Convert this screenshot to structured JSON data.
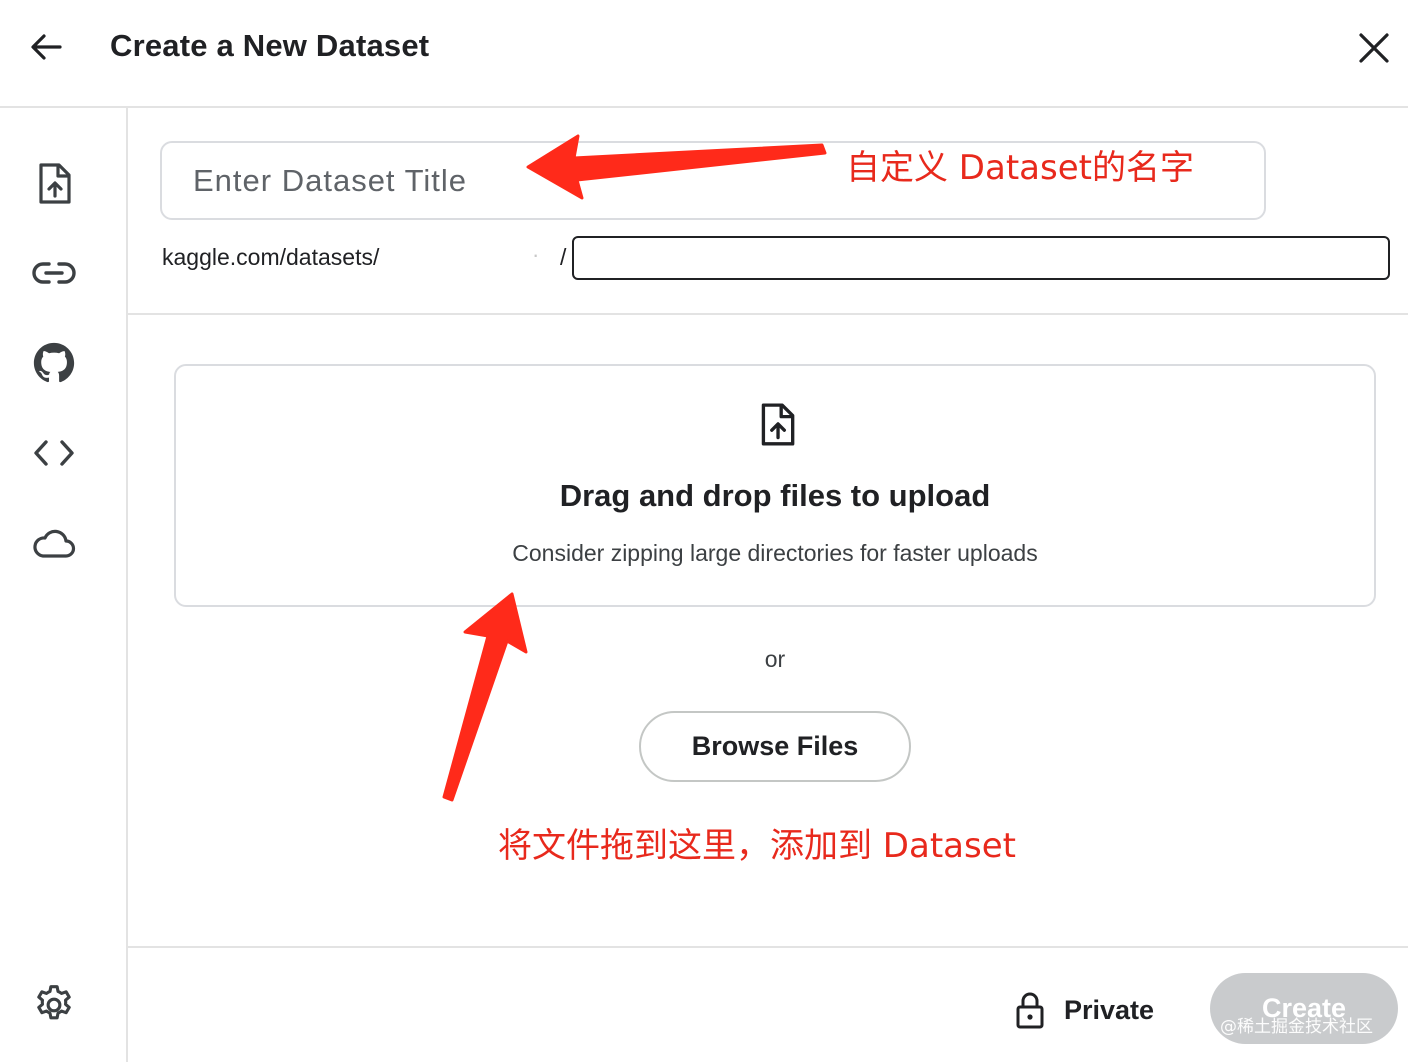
{
  "header": {
    "title": "Create a New Dataset",
    "back_icon": "arrow-left-icon",
    "close_icon": "close-icon"
  },
  "sidebar": {
    "items": [
      {
        "name": "file-upload",
        "icon": "file-upload-icon"
      },
      {
        "name": "link",
        "icon": "link-icon"
      },
      {
        "name": "github",
        "icon": "github-icon"
      },
      {
        "name": "code",
        "icon": "code-icon"
      },
      {
        "name": "cloud",
        "icon": "cloud-icon"
      }
    ],
    "settings_icon": "gear-icon"
  },
  "form": {
    "title_placeholder": "Enter Dataset Title",
    "url_prefix": "kaggle.com/datasets/",
    "url_user": "·",
    "url_separator": "/",
    "slug_value": ""
  },
  "dropzone": {
    "icon": "file-upload-icon",
    "title": "Drag and drop files to upload",
    "subtitle": "Consider zipping large directories for faster uploads"
  },
  "or_text": "or",
  "browse_label": "Browse Files",
  "footer": {
    "private_label": "Private",
    "private_icon": "lock-icon",
    "create_label": "Create"
  },
  "annotations": {
    "title_note": "自定义 Dataset的名字",
    "drop_note": "将文件拖到这里，添加到 Dataset",
    "color": "#e8291c"
  },
  "watermark": "@稀土掘金技术社区"
}
